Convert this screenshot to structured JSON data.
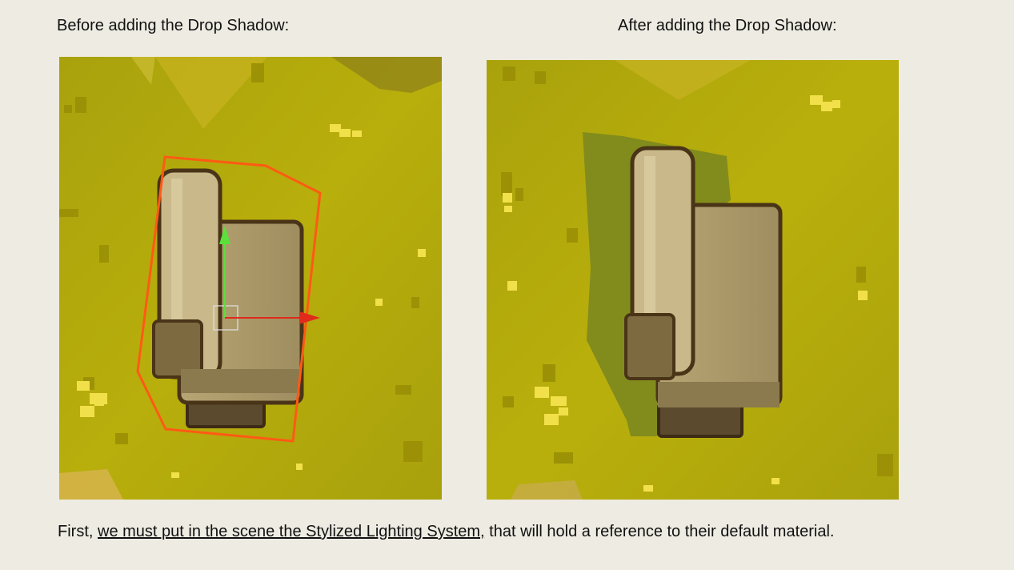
{
  "captions": {
    "before": "Before adding the Drop Shadow:",
    "after": "After adding the Drop Shadow:"
  },
  "images": {
    "before": {
      "alt": ""
    },
    "after": {
      "alt": ""
    }
  },
  "body": {
    "prefix": "First, ",
    "link": "we must put in the scene the Stylized Lighting System,",
    "suffix": " that will hold a reference to their default material."
  },
  "colors": {
    "page_background": "#eeebe2",
    "grass": "#b5ac0c",
    "selection_outline": "#ff5a14",
    "gizmo_y_axis": "#5be03b",
    "gizmo_x_axis": "#e02a1c",
    "drop_shadow": "#7e8a1e"
  }
}
